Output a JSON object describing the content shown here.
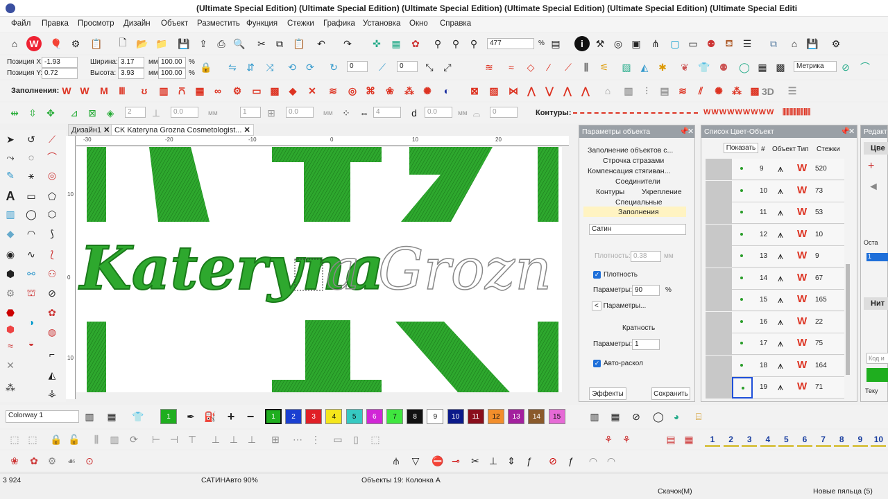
{
  "window": {
    "title": "(Ultimate Special Edition) (Ultimate Special Edition) (Ultimate Special Edition) (Ultimate Special Edition) (Ultimate Special Edition) (Ultimate Special Editi"
  },
  "menu": [
    "Файл",
    "Правка",
    "Просмотр",
    "Дизайн",
    "Объект",
    "Разместить",
    "Функция",
    "Стежки",
    "Графика",
    "Установка",
    "Окно",
    "Справка"
  ],
  "toolbar": {
    "zoom_value": "477",
    "zoom_unit": "%",
    "units": "Метрика"
  },
  "position": {
    "x_label": "Позиция X:",
    "x_value": "-1.93",
    "y_label": "Позиция Y:",
    "y_value": "0.72",
    "width_label": "Ширина:",
    "width_value": "3.17",
    "height_label": "Высота:",
    "height_value": "3.93",
    "unit_mm": "мм",
    "w_pct": "100.00",
    "h_pct": "100.00",
    "pct": "%",
    "rot1": "0",
    "rot2": "0"
  },
  "fills_label": "Заполнения:",
  "contours_label": "Контуры:",
  "label_3d": "3D",
  "row4": {
    "v1": "2",
    "v2": "0.0",
    "v3": "1",
    "v4": "0.0",
    "v5": "4",
    "v6": "0.0",
    "v7": "0",
    "mm": "мм"
  },
  "tabs": [
    {
      "label": "Дизайн1"
    },
    {
      "label": "CK Kateryna Grozna Cosmetologist..."
    }
  ],
  "rulers": {
    "h": [
      "-30",
      "-20",
      "-10",
      "0",
      "10",
      "20"
    ],
    "v": [
      "10",
      "0",
      "10"
    ]
  },
  "object_params": {
    "title": "Параметры объекта",
    "tree": [
      "Заполнение объектов с...",
      "Строчка стразами",
      "Компенсация стягиван...",
      "Соединители",
      "Контуры",
      "Укрепление",
      "Специальные",
      "Заполнения"
    ],
    "fill_type": "Сатин",
    "density_label": "Плотность:",
    "density_value": "0.38",
    "density_unit": "мм",
    "density_check": "Плотность",
    "params_label": "Параметры:",
    "params_value": "90",
    "params_unit": "%",
    "params_more": "Параметры...",
    "multiplicity": "Кратность",
    "params2_label": "Параметры:",
    "params2_value": "1",
    "auto_split": "Авто-раскол",
    "effects_button": "Эффекты",
    "save_button": "Сохранить"
  },
  "color_list": {
    "title": "Список Цвет-Объект",
    "show_button": "Показать",
    "headers": [
      "#",
      "Объект",
      "Тип",
      "Стежки"
    ],
    "rows": [
      {
        "n": "9",
        "s": "520"
      },
      {
        "n": "10",
        "s": "73"
      },
      {
        "n": "11",
        "s": "53"
      },
      {
        "n": "12",
        "s": "10"
      },
      {
        "n": "13",
        "s": "9"
      },
      {
        "n": "14",
        "s": "67"
      },
      {
        "n": "15",
        "s": "165"
      },
      {
        "n": "16",
        "s": "22"
      },
      {
        "n": "17",
        "s": "75"
      },
      {
        "n": "18",
        "s": "164"
      },
      {
        "n": "19",
        "s": "71"
      }
    ]
  },
  "right_edge": {
    "title": "Редакт",
    "sect1": "Цве",
    "sect2": "Нит",
    "rest": "Оста",
    "one": "1",
    "code": "Код и",
    "cur": "Теку"
  },
  "colorway": "Colorway 1",
  "palette": [
    {
      "n": "1",
      "c": "#1fae1f"
    },
    {
      "n": "2",
      "c": "#1a3fd1"
    },
    {
      "n": "3",
      "c": "#e01f26"
    },
    {
      "n": "4",
      "c": "#f5e61b"
    },
    {
      "n": "5",
      "c": "#36c9c2"
    },
    {
      "n": "6",
      "c": "#d126d6"
    },
    {
      "n": "7",
      "c": "#3fe63f"
    },
    {
      "n": "8",
      "c": "#111111"
    },
    {
      "n": "9",
      "c": "#ffffff"
    },
    {
      "n": "10",
      "c": "#0b1a8a"
    },
    {
      "n": "11",
      "c": "#8a0e1b"
    },
    {
      "n": "12",
      "c": "#f28e2b"
    },
    {
      "n": "13",
      "c": "#a3209e"
    },
    {
      "n": "14",
      "c": "#8a5a2b"
    },
    {
      "n": "15",
      "c": "#e66ad6"
    }
  ],
  "numbered": [
    "1",
    "2",
    "3",
    "4",
    "5",
    "6",
    "7",
    "8",
    "9",
    "10"
  ],
  "design_text": {
    "stitched": "Kateryna",
    "outline": "a Grozn"
  },
  "status": {
    "count": "3 924",
    "type": "САТИНАвто 90%",
    "objects": "Объекты 19: Колонка A",
    "jump": "Скачок(М)",
    "hoops": "Новые пяльца (5)"
  },
  "colors": {
    "accent_fill": "#d32f2f",
    "thread_green": "#2a9d2a",
    "panel_highlight": "#fff3c2"
  }
}
